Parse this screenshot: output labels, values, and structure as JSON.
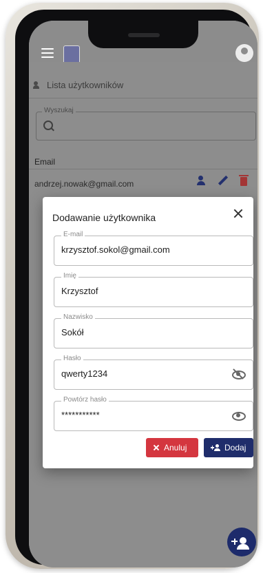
{
  "app": {
    "list_title": "Lista użytkowników",
    "search": {
      "label": "Wyszukaj",
      "value": ""
    },
    "table": {
      "columns": [
        "Email"
      ],
      "rows": [
        {
          "email": "andrzej.nowak@gmail.com"
        }
      ]
    }
  },
  "dialog": {
    "title": "Dodawanie użytkownika",
    "fields": {
      "email": {
        "label": "E-mail",
        "value": "krzysztof.sokol@gmail.com"
      },
      "first_name": {
        "label": "Imię",
        "value": "Krzysztof"
      },
      "last_name": {
        "label": "Nazwisko",
        "value": "Sokół"
      },
      "password": {
        "label": "Hasło",
        "value": "qwerty1234"
      },
      "repeat_password": {
        "label": "Powtórz hasło",
        "value": "***********"
      }
    },
    "buttons": {
      "cancel": "Anuluj",
      "add": "Dodaj"
    }
  },
  "colors": {
    "primary": "#1f2d6b",
    "danger": "#d4363f",
    "overlay": "#8d8d8d"
  }
}
